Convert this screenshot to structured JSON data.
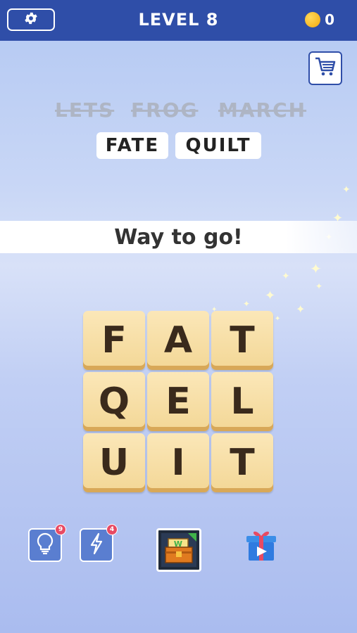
{
  "header": {
    "level_title": "LEVEL 8",
    "coin_count": "0",
    "settings_icon": "gear-icon",
    "coin_icon": "coin-icon"
  },
  "shop": {
    "icon": "cart-icon"
  },
  "found_words": [
    "LETS",
    "FROG",
    "MARCH"
  ],
  "target_words": [
    "FATE",
    "QUILT"
  ],
  "banner": {
    "message": "Way to go!"
  },
  "board": {
    "tiles": [
      "F",
      "A",
      "T",
      "Q",
      "E",
      "L",
      "U",
      "I",
      "T"
    ]
  },
  "tools": {
    "hint": {
      "icon": "lightbulb-icon",
      "count": "9"
    },
    "bolt": {
      "icon": "lightning-icon",
      "count": "4"
    },
    "chest": {
      "icon": "treasure-chest-icon",
      "letter": "W"
    },
    "gift": {
      "icon": "gift-video-icon"
    }
  },
  "colors": {
    "header": "#2f4ea8",
    "tile": "#f3d796",
    "badge": "#e84a63"
  }
}
